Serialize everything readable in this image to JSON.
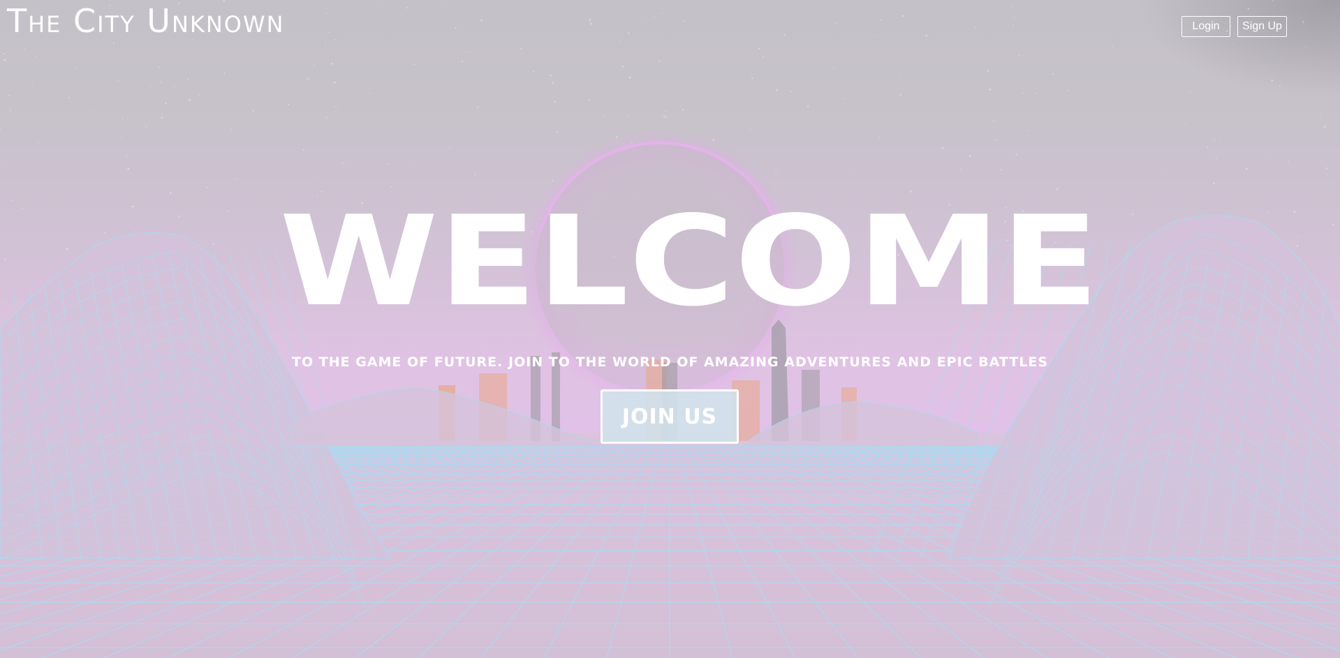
{
  "header": {
    "brand": "The City Unknown",
    "login_label": "Login",
    "signup_label": "Sign Up"
  },
  "hero": {
    "title": "WELCOME",
    "subtitle": "TO THE GAME OF FUTURE. JOIN TO THE WORLD OF AMAZING ADVENTURES AND EPIC BATTLES",
    "cta_label": "JOIN US"
  },
  "background": {
    "icons": [
      "retro-sun-icon",
      "city-skyline-icon",
      "wireframe-mountains-icon",
      "grid-floor-icon",
      "stars-icon"
    ],
    "colors": {
      "sky": "#c4c1c8",
      "horizon": "#dfc3e2",
      "grid": "#a9dcf2",
      "sun_rim": "#e8a6ef",
      "skyline_grey": "#9c9aa3",
      "skyline_orange": "#e8a88e"
    }
  }
}
